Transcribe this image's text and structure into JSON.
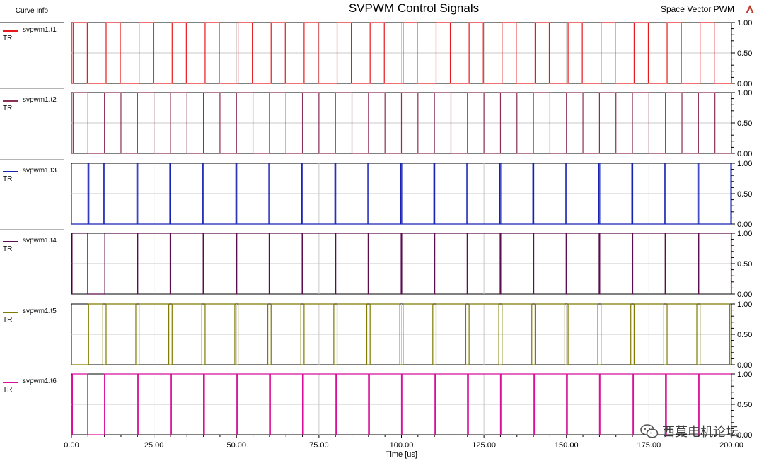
{
  "panel": {
    "header": "Curve Info"
  },
  "header": {
    "title": "SVPWM Control Signals",
    "subtitle": "Space Vector PWM"
  },
  "watermark": {
    "text": "西莫电机论坛",
    "icon": "wechat-icon"
  },
  "colors": {
    "t1": "#e8191c",
    "t2": "#8c2f55",
    "t3": "#1722b4",
    "t4": "#5b0d4e",
    "t5": "#7f7b00",
    "t6": "#d70f9a",
    "grid": "#c8c8c8",
    "frame": "#000000"
  },
  "chart_data": {
    "type": "line",
    "title": "SVPWM Control Signals",
    "subtitle": "Space Vector PWM",
    "xlabel": "Time [us]",
    "xlim": [
      0,
      200
    ],
    "x_ticks": [
      "0.00",
      "25.00",
      "50.00",
      "75.00",
      "100.00",
      "125.00",
      "150.00",
      "175.00",
      "200.00"
    ],
    "ylim": [
      0,
      1
    ],
    "y_ticks": [
      "0.00",
      "0.50",
      "1.00"
    ],
    "grid": true,
    "carrier_period_us": 10,
    "series": [
      {
        "name": "svpwm1.t1",
        "unit": "TR",
        "color": "#e8191c",
        "high_intervals": [
          [
            0.5,
            4.8
          ],
          [
            10.5,
            14.8
          ],
          [
            20.5,
            24.8
          ],
          [
            30.5,
            34.8
          ],
          [
            40.5,
            44.8
          ],
          [
            50.5,
            54.8
          ],
          [
            60.5,
            64.8
          ],
          [
            70.5,
            74.8
          ],
          [
            80.5,
            84.8
          ],
          [
            90.5,
            94.8
          ],
          [
            100.5,
            104.8
          ],
          [
            110.5,
            114.8
          ],
          [
            120.5,
            124.8
          ],
          [
            130.5,
            134.8
          ],
          [
            140.5,
            144.8
          ],
          [
            150.5,
            154.8
          ],
          [
            160.5,
            164.8
          ],
          [
            170.5,
            174.8
          ],
          [
            180.5,
            184.8
          ],
          [
            190.5,
            194.8
          ]
        ]
      },
      {
        "name": "svpwm1.t2",
        "unit": "TR",
        "color": "#8c2f55",
        "high_intervals": [
          [
            0.5,
            5.0
          ],
          [
            10.0,
            15.0
          ],
          [
            20.0,
            25.0
          ],
          [
            30.0,
            35.0
          ],
          [
            40.0,
            45.0
          ],
          [
            50.0,
            55.0
          ],
          [
            60.0,
            65.0
          ],
          [
            70.0,
            75.0
          ],
          [
            80.0,
            85.0
          ],
          [
            90.0,
            95.0
          ],
          [
            100.0,
            105.0
          ],
          [
            110.0,
            115.0
          ],
          [
            120.0,
            125.0
          ],
          [
            130.0,
            135.0
          ],
          [
            140.0,
            145.0
          ],
          [
            150.0,
            155.0
          ],
          [
            160.0,
            165.0
          ],
          [
            170.0,
            175.0
          ],
          [
            180.0,
            185.0
          ],
          [
            190.0,
            195.0
          ]
        ]
      },
      {
        "name": "svpwm1.t3",
        "unit": "TR",
        "color": "#1722b4",
        "high_intervals": [
          [
            5.0,
            5.3
          ],
          [
            9.8,
            10.1
          ],
          [
            19.8,
            20.1
          ],
          [
            29.8,
            30.1
          ],
          [
            39.8,
            40.1
          ],
          [
            49.8,
            50.1
          ],
          [
            59.8,
            60.1
          ],
          [
            69.8,
            70.1
          ],
          [
            79.8,
            80.1
          ],
          [
            89.8,
            90.1
          ],
          [
            99.8,
            100.1
          ],
          [
            109.8,
            110.1
          ],
          [
            119.8,
            120.1
          ],
          [
            129.8,
            130.1
          ],
          [
            139.8,
            140.1
          ],
          [
            149.8,
            150.1
          ],
          [
            159.8,
            160.1
          ],
          [
            169.8,
            170.1
          ],
          [
            179.8,
            180.1
          ],
          [
            189.8,
            190.1
          ],
          [
            199.8,
            200.0
          ]
        ]
      },
      {
        "name": "svpwm1.t4",
        "unit": "TR",
        "color": "#5b0d4e",
        "high_intervals": [
          [
            0.2,
            4.9
          ],
          [
            10.1,
            19.9
          ],
          [
            20.1,
            29.9
          ],
          [
            30.1,
            39.9
          ],
          [
            40.1,
            49.9
          ],
          [
            50.1,
            59.9
          ],
          [
            60.1,
            69.9
          ],
          [
            70.1,
            79.9
          ],
          [
            80.1,
            89.9
          ],
          [
            90.1,
            99.9
          ],
          [
            100.1,
            109.9
          ],
          [
            110.1,
            119.9
          ],
          [
            120.1,
            129.9
          ],
          [
            130.1,
            139.9
          ],
          [
            140.1,
            149.9
          ],
          [
            150.1,
            159.9
          ],
          [
            160.1,
            169.9
          ],
          [
            170.1,
            179.9
          ],
          [
            180.1,
            189.9
          ],
          [
            190.1,
            199.9
          ]
        ]
      },
      {
        "name": "svpwm1.t5",
        "unit": "TR",
        "color": "#7f7b00",
        "high_intervals": [
          [
            5.2,
            9.5
          ],
          [
            10.5,
            19.5
          ],
          [
            20.5,
            29.5
          ],
          [
            30.5,
            39.5
          ],
          [
            40.5,
            49.5
          ],
          [
            50.5,
            59.5
          ],
          [
            60.5,
            69.5
          ],
          [
            70.5,
            79.5
          ],
          [
            80.5,
            89.5
          ],
          [
            90.5,
            99.5
          ],
          [
            100.5,
            109.5
          ],
          [
            110.5,
            119.5
          ],
          [
            120.5,
            129.5
          ],
          [
            130.5,
            139.5
          ],
          [
            140.5,
            149.5
          ],
          [
            150.5,
            159.5
          ],
          [
            160.5,
            169.5
          ],
          [
            170.5,
            179.5
          ],
          [
            180.5,
            189.5
          ],
          [
            190.5,
            199.5
          ]
        ]
      },
      {
        "name": "svpwm1.t6",
        "unit": "TR",
        "color": "#d70f9a",
        "high_intervals": [
          [
            0.3,
            4.9
          ],
          [
            10.0,
            20.0
          ],
          [
            20.3,
            30.0
          ],
          [
            30.3,
            40.0
          ],
          [
            40.3,
            50.0
          ],
          [
            50.3,
            60.0
          ],
          [
            60.3,
            70.0
          ],
          [
            70.3,
            80.0
          ],
          [
            80.3,
            90.0
          ],
          [
            90.3,
            100.0
          ],
          [
            100.3,
            110.0
          ],
          [
            110.3,
            120.0
          ],
          [
            120.3,
            130.0
          ],
          [
            130.3,
            140.0
          ],
          [
            140.3,
            150.0
          ],
          [
            150.3,
            160.0
          ],
          [
            160.3,
            170.0
          ],
          [
            170.3,
            180.0
          ],
          [
            180.3,
            190.0
          ],
          [
            190.3,
            200.0
          ]
        ]
      }
    ]
  }
}
